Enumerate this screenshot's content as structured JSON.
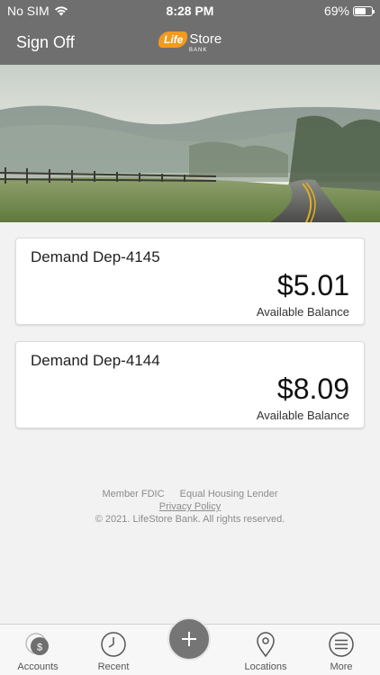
{
  "status": {
    "carrier": "No SIM",
    "time": "8:28 PM",
    "battery": "69%",
    "battery_level": 0.69
  },
  "nav": {
    "sign_off": "Sign Off",
    "logo_life": "Life",
    "logo_store": "Store",
    "logo_bank": "BANK"
  },
  "accounts": [
    {
      "name": "Demand Dep-4145",
      "balance": "$5.01",
      "balance_label": "Available Balance"
    },
    {
      "name": "Demand Dep-4144",
      "balance": "$8.09",
      "balance_label": "Available Balance"
    }
  ],
  "footer": {
    "member_fdic": "Member FDIC",
    "equal_housing": "Equal Housing Lender",
    "privacy": "Privacy Policy",
    "copyright": "© 2021. LifeStore Bank. All rights reserved."
  },
  "tabs": [
    {
      "label": "Accounts",
      "icon": "accounts-dollar-icon"
    },
    {
      "label": "Recent",
      "icon": "clock-icon"
    },
    {
      "label": "",
      "icon": "plus-icon"
    },
    {
      "label": "Locations",
      "icon": "location-pin-icon"
    },
    {
      "label": "More",
      "icon": "menu-lines-icon"
    }
  ],
  "colors": {
    "header": "#6f6f6f",
    "logo_orange": "#f29a1e",
    "background": "#f2f2f2"
  }
}
